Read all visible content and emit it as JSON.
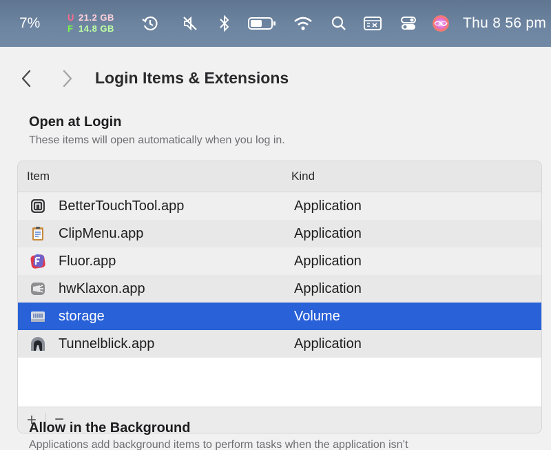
{
  "menubar": {
    "battery_percent": "7%",
    "memory": {
      "used_tag": "U",
      "used_value": "21.2 GB",
      "free_tag": "F",
      "free_value": "14.8 GB"
    },
    "clock": "Thu 8 56 pm",
    "icons": [
      "history-icon",
      "mute-icon",
      "bluetooth-icon",
      "battery-icon",
      "wifi-icon",
      "spotlight-search-icon",
      "keyboard-viewer-icon",
      "control-center-icon",
      "siri-icon"
    ]
  },
  "window": {
    "title": "Login Items & Extensions",
    "open_at_login": {
      "title": "Open at Login",
      "subtitle": "These items will open automatically when you log in.",
      "columns": {
        "item": "Item",
        "kind": "Kind"
      },
      "rows": [
        {
          "name": "BetterTouchTool.app",
          "kind": "Application",
          "icon": "bettertouchtool-icon"
        },
        {
          "name": "ClipMenu.app",
          "kind": "Application",
          "icon": "clipmenu-icon"
        },
        {
          "name": "Fluor.app",
          "kind": "Application",
          "icon": "fluor-icon"
        },
        {
          "name": "hwKlaxon.app",
          "kind": "Application",
          "icon": "hwklaxon-icon"
        },
        {
          "name": "storage",
          "kind": "Volume",
          "icon": "volume-drive-icon",
          "selected": true
        },
        {
          "name": "Tunnelblick.app",
          "kind": "Application",
          "icon": "tunnelblick-icon"
        }
      ],
      "add_label": "+",
      "remove_label": "−"
    },
    "allow_in_background": {
      "title": "Allow in the Background",
      "subtitle": "Applications add background items to perform tasks when the application isn’t"
    }
  },
  "colors": {
    "selection": "#2861d8",
    "menubar": "#6e86a2"
  }
}
